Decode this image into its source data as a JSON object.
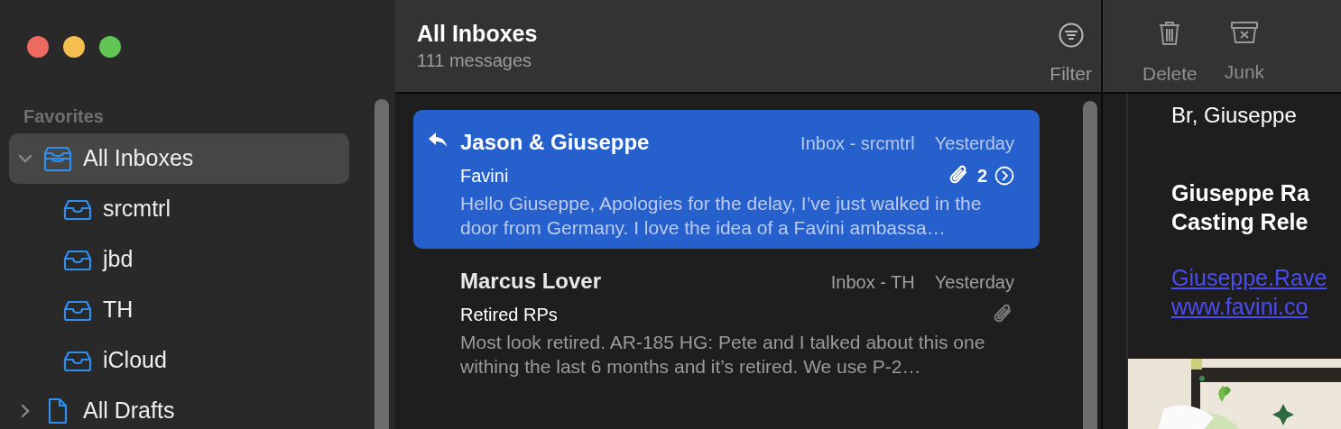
{
  "sidebar": {
    "section": "Favorites",
    "items": [
      {
        "label": "All Inboxes",
        "kind": "inboxes",
        "expanded": true,
        "selected": true,
        "children": [
          {
            "label": "srcmtrl",
            "kind": "inbox",
            "selected": false
          },
          {
            "label": "jbd",
            "kind": "inbox",
            "selected": false
          },
          {
            "label": "TH",
            "kind": "inbox",
            "selected": false
          },
          {
            "label": "iCloud",
            "kind": "inbox",
            "selected": false
          }
        ]
      },
      {
        "label": "All Drafts",
        "kind": "drafts",
        "expanded": false,
        "selected": false
      }
    ]
  },
  "message_list": {
    "title": "All Inboxes",
    "subtitle": "111 messages",
    "filter_button": "Filter",
    "messages": [
      {
        "sender": "Jason & Giuseppe",
        "mailbox": "Inbox - srcmtrl",
        "date": "Yesterday",
        "subject": "Favini",
        "preview": "Hello Giuseppe, Apologies for the delay, I’ve just walked in the door from Germany. I love the idea of a Favini ambassa…",
        "selected": true,
        "replied": true,
        "has_attachment": true,
        "thread_count": "2"
      },
      {
        "sender": "Marcus Lover",
        "mailbox": "Inbox - TH",
        "date": "Yesterday",
        "subject": "Retired RPs",
        "preview": "Most look retired. AR-185 HG: Pete and I talked about this one withing the last 6 months and it’s retired. We use P-2…",
        "selected": false,
        "replied": false,
        "has_attachment": true
      }
    ]
  },
  "toolbar": [
    {
      "label": "Delete",
      "kind": "delete"
    },
    {
      "label": "Junk",
      "kind": "junk"
    }
  ],
  "reader": {
    "signoff": "Br, Giuseppe",
    "signature": [
      "Giuseppe Ra",
      "Casting Rele"
    ],
    "links": [
      "Giuseppe.Rave",
      "www.favini.co"
    ]
  }
}
